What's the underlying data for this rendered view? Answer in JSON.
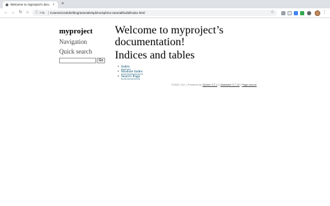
{
  "browser": {
    "tab_title": "Welcome to myproject's docu",
    "tab_close_icon": "×",
    "new_tab_icon": "+",
    "address_info_icon": "ⓘ",
    "address_scheme_label": "File",
    "address_url": "/Users/ezzeldin/blog/tutorials/sphinx/sphinx-tutorial/build/index.html",
    "star_icon": "☆",
    "menu_icon": "⋮",
    "nav_icons": {
      "back": "←",
      "forward": "→",
      "reload": "↻",
      "home": "⌂"
    }
  },
  "sidebar": {
    "project_name": "myproject",
    "navigation_heading": "Navigation",
    "quick_search_heading": "Quick search",
    "search_input_value": "",
    "go_button_label": "Go"
  },
  "main": {
    "title_line1": "Welcome to myproject’s",
    "title_line2": "documentation!",
    "indices_heading": "Indices and tables",
    "links": [
      {
        "label": "Index"
      },
      {
        "label": "Module Index"
      },
      {
        "label": "Search Page"
      }
    ]
  },
  "footer": {
    "copyright": "©2020, Ezz.",
    "powered_by": "| Powered by",
    "sphinx_link": "Sphinx 3.2.1",
    "and": "&",
    "alabaster_link": "Alabaster 0.7.12",
    "sep": "|",
    "page_source_link": "Page source"
  },
  "colors": {
    "link": "#004b6b",
    "tabstrip": "#dee1e6",
    "omnibox": "#f1f3f4"
  }
}
